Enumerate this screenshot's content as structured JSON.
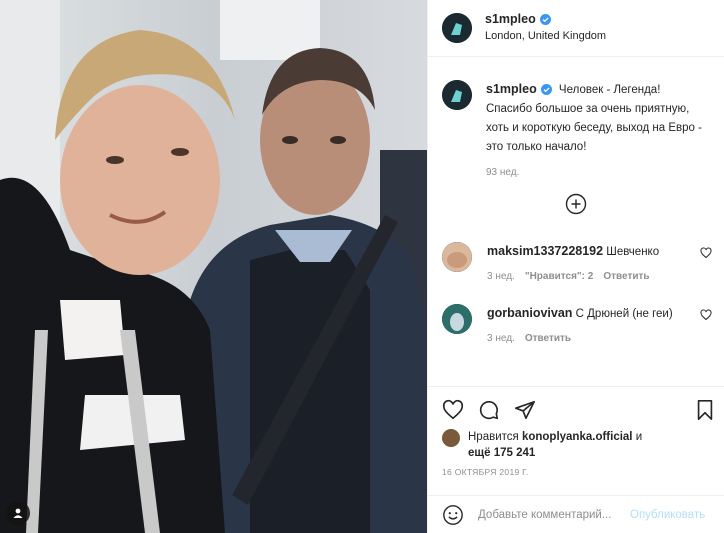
{
  "post": {
    "username": "s1mpleo",
    "location": "London, United Kingdom",
    "caption": "Человек - Легенда! Спасибо большое за очень приятную, хоть и короткую беседу, выход на Евро - это только начало!",
    "caption_age": "93 нед."
  },
  "comments": [
    {
      "username": "maksim1337228192",
      "text": "Шевченко",
      "age": "3 нед.",
      "likes": "\"Нравится\": 2",
      "reply_label": "Ответить"
    },
    {
      "username": "gorbaniovivan",
      "text": "С Дрюней (не геи)",
      "age": "3 нед.",
      "reply_label": "Ответить"
    }
  ],
  "likes": {
    "prefix": "Нравится",
    "user": "konoplyanka.official",
    "connector": "и",
    "others": "ещё 175 241"
  },
  "date": "16 ОКТЯБРЯ 2019 Г.",
  "add_comment": {
    "placeholder": "Добавьте комментарий...",
    "post_label": "Опубликовать"
  },
  "icons": {
    "verified": "verified-badge-icon",
    "load_more": "plus-circle-icon",
    "like": "heart-icon",
    "comment": "comment-bubble-icon",
    "share": "paper-plane-icon",
    "save": "bookmark-icon",
    "emoji": "smiley-icon",
    "tags": "user-tag-icon"
  },
  "colors": {
    "accent": "#0095f6",
    "verified": "#3897f0",
    "muted": "#8e8e8e",
    "post_disabled": "#b2dffc"
  }
}
